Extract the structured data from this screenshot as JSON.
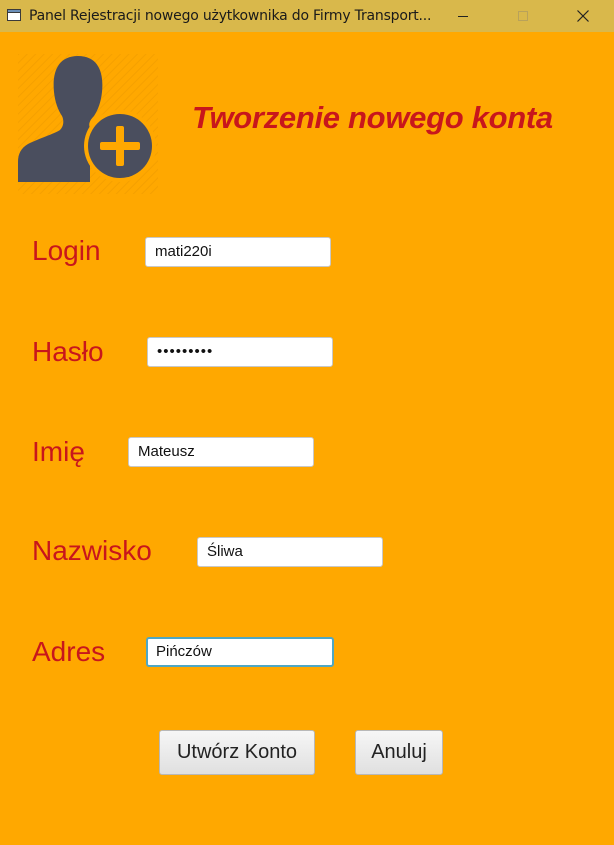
{
  "window": {
    "title": "Panel Rejestracji nowego użytkownika do Firmy Transport...",
    "controls": [
      "minimize",
      "maximize",
      "close"
    ]
  },
  "header": {
    "icon": "add-user-icon",
    "heading": "Tworzenie nowego konta"
  },
  "form": {
    "login": {
      "label": "Login",
      "value": "mati220i"
    },
    "password": {
      "label": "Hasło",
      "masked_value": "•••••••••"
    },
    "first_name": {
      "label": "Imię",
      "value": "Mateusz"
    },
    "last_name": {
      "label": "Nazwisko",
      "value": "Śliwa"
    },
    "address": {
      "label": "Adres",
      "value": "Pińczów",
      "focused": true
    }
  },
  "buttons": {
    "create": "Utwórz Konto",
    "cancel": "Anuluj"
  },
  "colors": {
    "background": "#FFA800",
    "titlebar": "#D9B84B",
    "label_text": "#C8161C",
    "icon": "#4A4E5E",
    "focus_border": "#4FA7C4"
  }
}
